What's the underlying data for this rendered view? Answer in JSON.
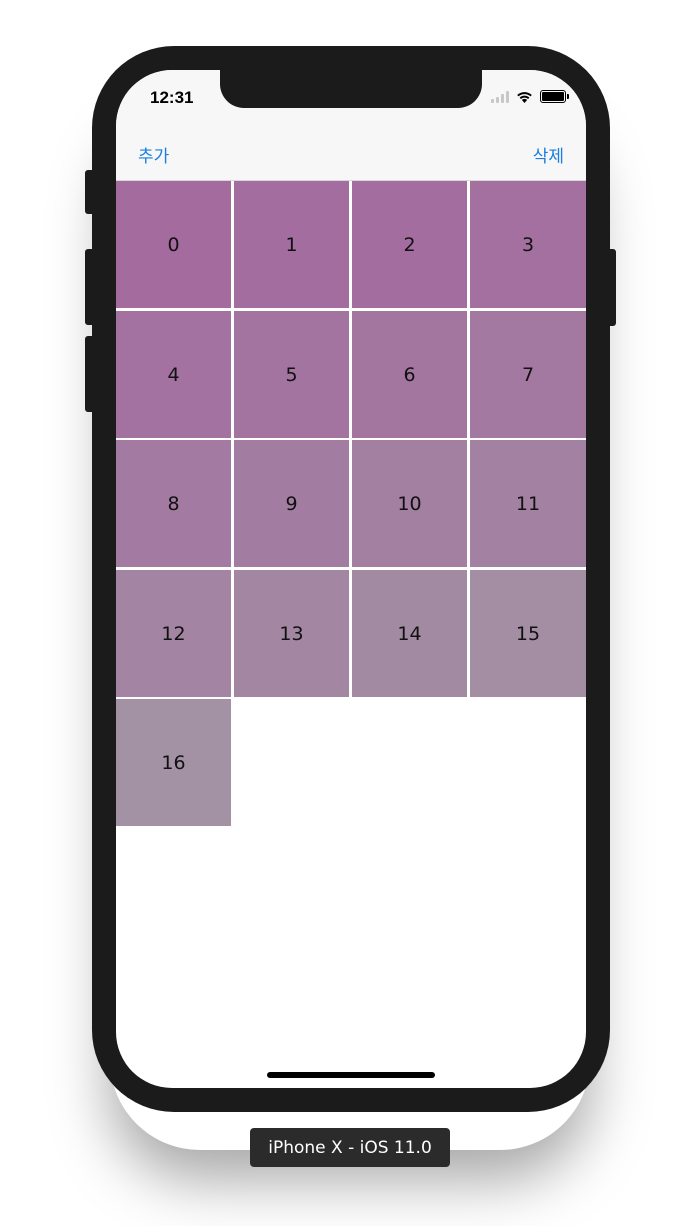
{
  "status_bar": {
    "time": "12:31"
  },
  "nav": {
    "left_label": "추가",
    "right_label": "삭제"
  },
  "cells": [
    {
      "label": "0",
      "color": "#a46b9f"
    },
    {
      "label": "1",
      "color": "#a46d9f"
    },
    {
      "label": "2",
      "color": "#a36e9f"
    },
    {
      "label": "3",
      "color": "#a370a0"
    },
    {
      "label": "4",
      "color": "#a372a0"
    },
    {
      "label": "5",
      "color": "#a374a0"
    },
    {
      "label": "6",
      "color": "#a376a0"
    },
    {
      "label": "7",
      "color": "#a378a1"
    },
    {
      "label": "8",
      "color": "#a37aa1"
    },
    {
      "label": "9",
      "color": "#a37ca1"
    },
    {
      "label": "10",
      "color": "#a37fa1"
    },
    {
      "label": "11",
      "color": "#a381a2"
    },
    {
      "label": "12",
      "color": "#a384a2"
    },
    {
      "label": "13",
      "color": "#a387a2"
    },
    {
      "label": "14",
      "color": "#a38aa3"
    },
    {
      "label": "15",
      "color": "#a38ea3"
    },
    {
      "label": "16",
      "color": "#a392a3"
    }
  ],
  "device_label": "iPhone X - iOS 11.0"
}
